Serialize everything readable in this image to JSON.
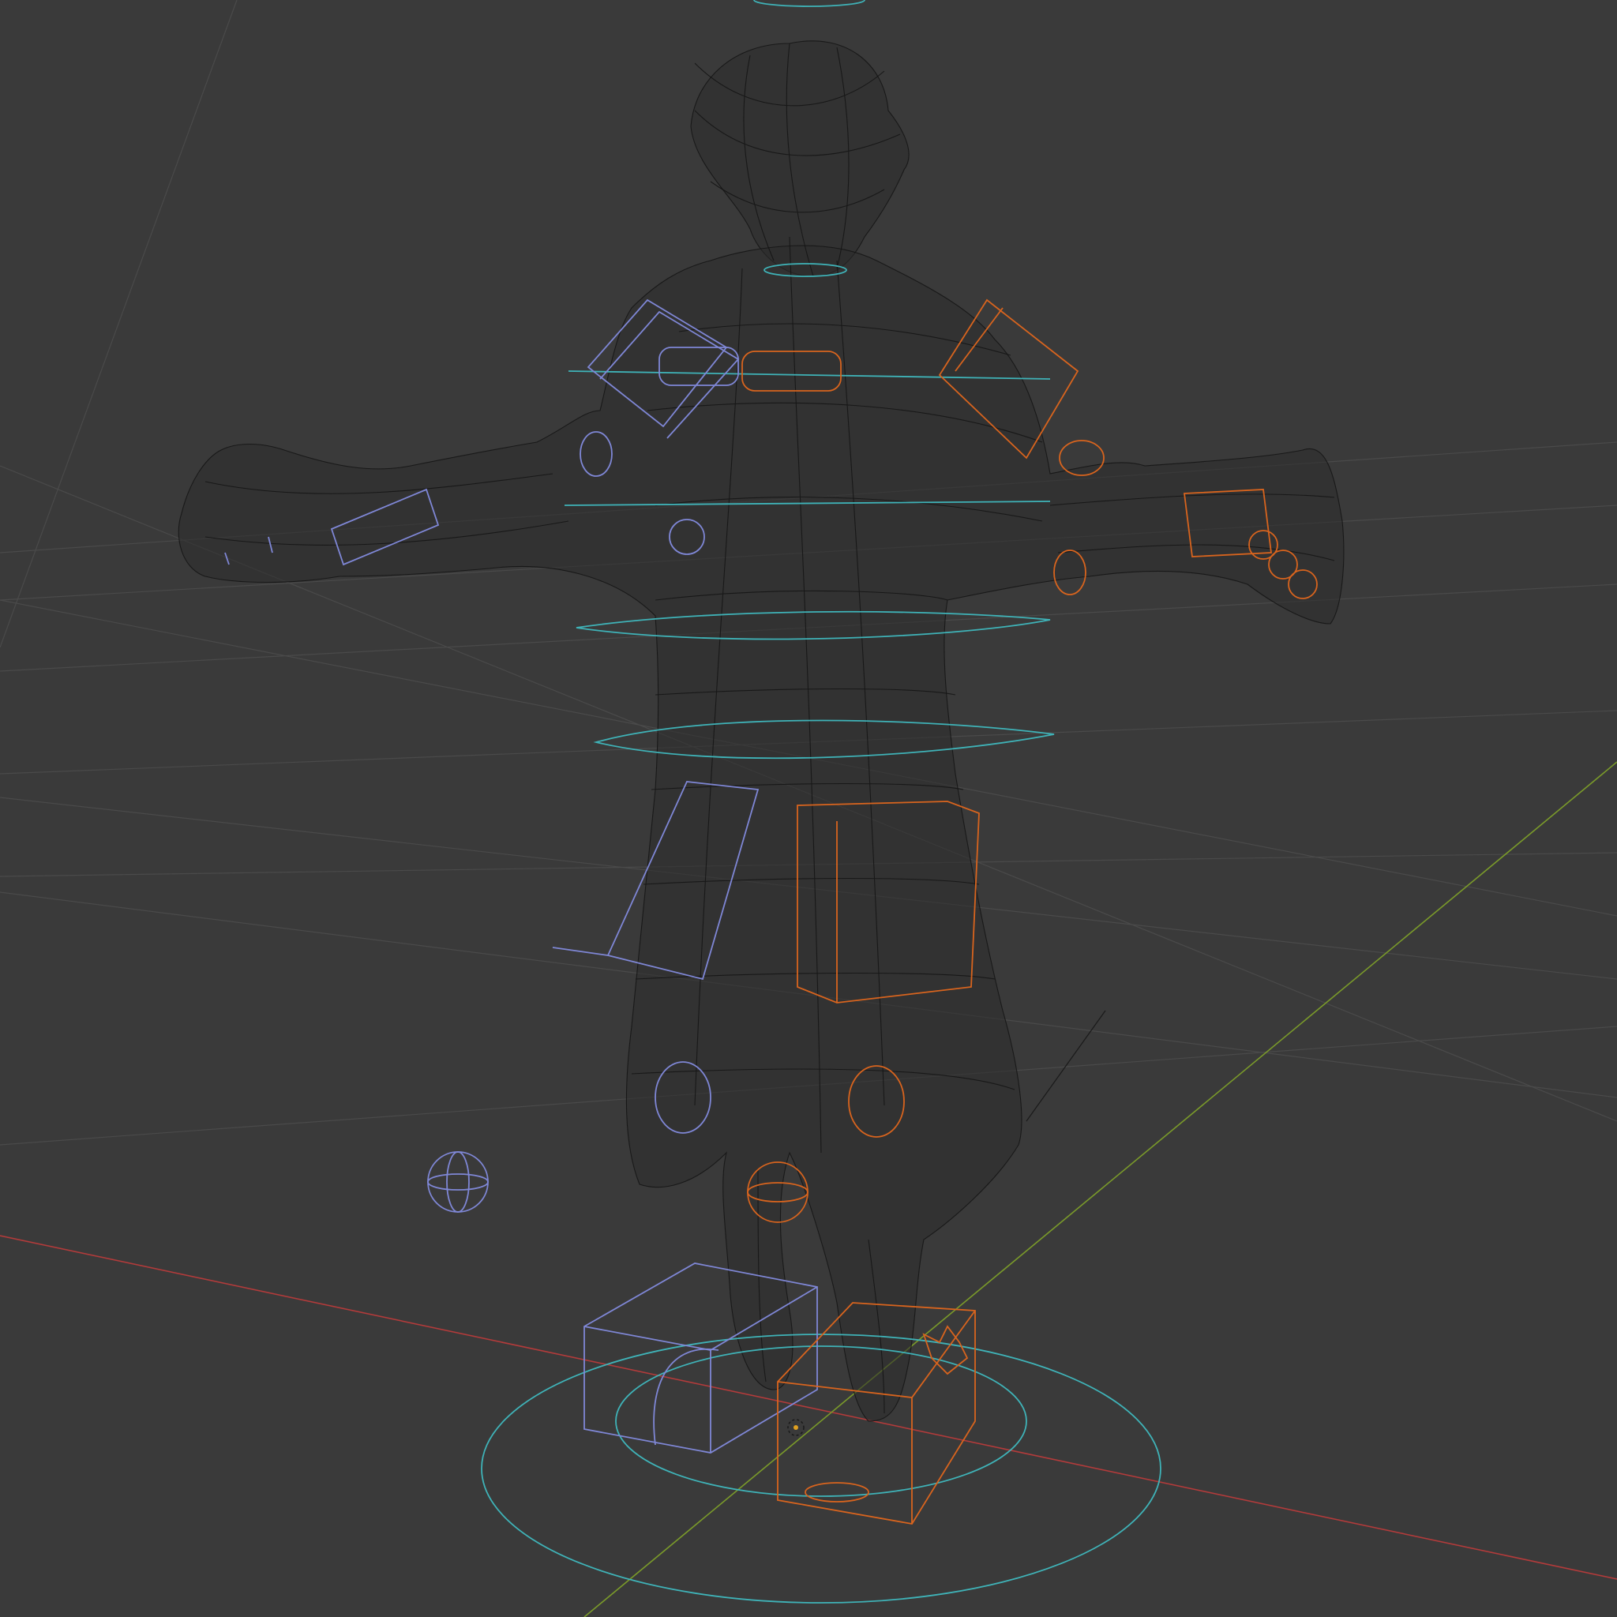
{
  "viewport": {
    "mode": "wireframe",
    "background": "#3a3a3a"
  },
  "colors": {
    "grid": "#4a4a4a",
    "axis_x": "#b23b3b",
    "axis_y": "#7a9a2a",
    "mesh": "#141414",
    "rig_center": "#3fb3b8",
    "rig_left": "#7f87d6",
    "rig_right": "#d8641e"
  },
  "scene": {
    "character": "rigged-character-wireframe",
    "controls": [
      "cyan-ring-controls",
      "blue-left-ik-controls",
      "orange-right-ik-controls",
      "root-circle"
    ]
  }
}
